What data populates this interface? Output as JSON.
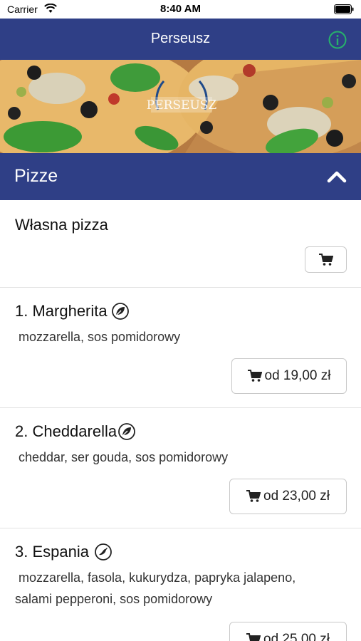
{
  "status_bar": {
    "carrier": "Carrier",
    "time": "8:40 AM"
  },
  "nav": {
    "title": "Perseusz",
    "info_icon": "info-icon",
    "accent_color": "#2f3f86",
    "info_color": "#27b26b"
  },
  "hero": {
    "logo_text": "PERSEUSZ"
  },
  "category": {
    "title": "Pizze",
    "chevron_icon": "chevron-up-icon"
  },
  "items": [
    {
      "title": "Własna pizza",
      "description": "",
      "price": ""
    },
    {
      "title": "1. Margherita",
      "description": "mozzarella, sos pomidorowy",
      "price": "od 19,00 zł",
      "icon": "leaf-icon"
    },
    {
      "title": "2. Cheddarella",
      "description": "cheddar, ser gouda, sos pomidorowy",
      "price": "od 23,00 zł",
      "icon": "leaf-icon"
    },
    {
      "title": "3. Espania",
      "description": "mozzarella, fasola, kukurydza, papryka jalapeno, salami pepperoni, sos pomidorowy",
      "price": "od 25,00 zł",
      "icon": "chili-icon"
    }
  ]
}
